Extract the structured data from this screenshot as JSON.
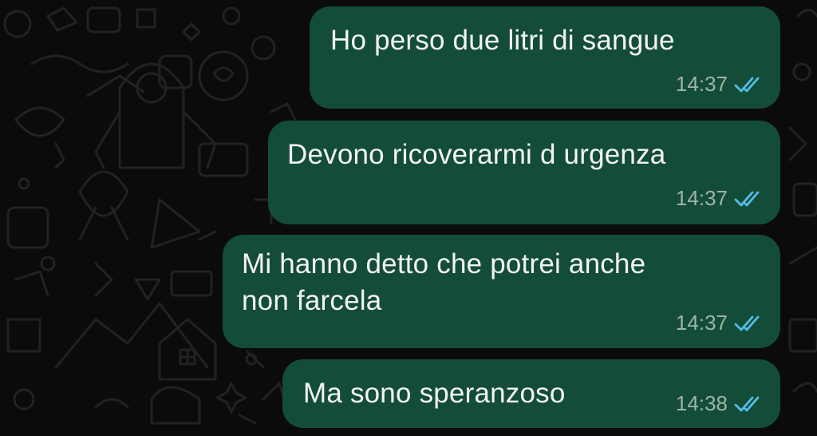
{
  "theme": {
    "background": "#0b0b0b",
    "bubble_color": "#134d37",
    "text_color": "#f3f3f3",
    "time_color": "#9fb3aa",
    "read_tick_color": "#53bdeb"
  },
  "messages": [
    {
      "text": "Ho perso due litri di sangue",
      "time": "14:37",
      "status_icon": "double-check-read-icon"
    },
    {
      "text": "Devono ricoverarmi d urgenza",
      "time": "14:37",
      "status_icon": "double-check-read-icon"
    },
    {
      "text": "Mi hanno detto che potrei anche\nnon farcela",
      "time": "14:37",
      "status_icon": "double-check-read-icon"
    },
    {
      "text": "Ma sono speranzoso",
      "time": "14:38",
      "status_icon": "double-check-read-icon"
    }
  ]
}
